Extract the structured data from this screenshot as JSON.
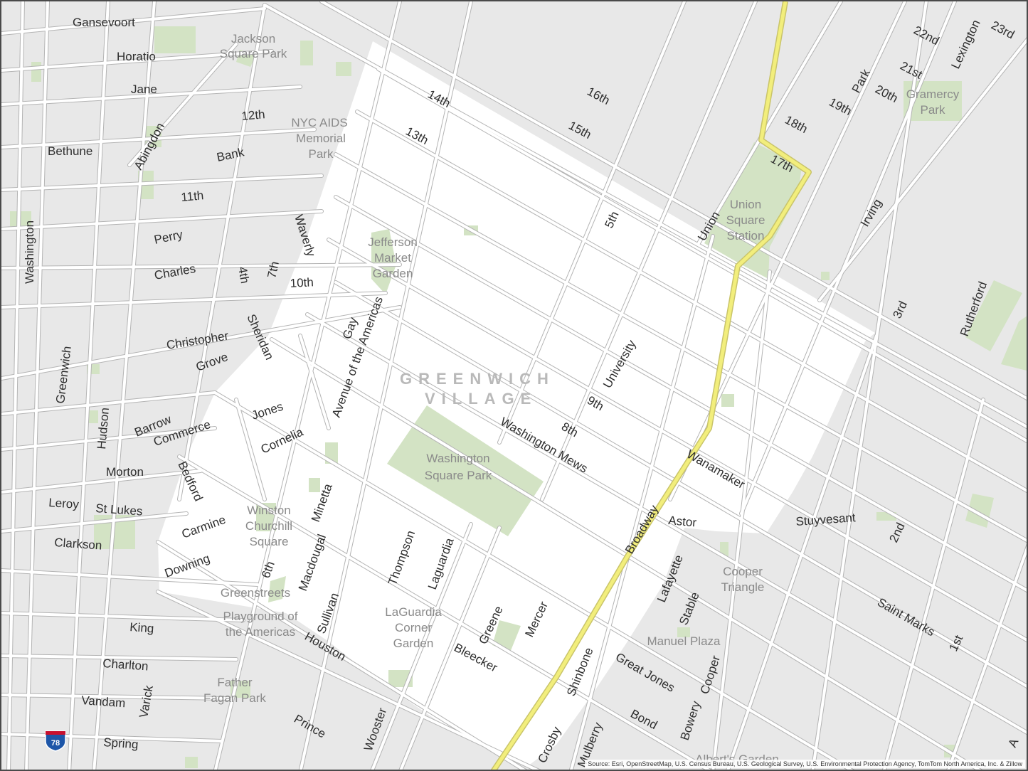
{
  "map": {
    "neighborhood": [
      "GREENWICH",
      "VILLAGE"
    ],
    "attribution": "Source: Esri, OpenStreetMap, U.S. Census Bureau, U.S. Geological Survey, U.S. Environmental Protection Agency, TomTom North America, Inc. & Zillow",
    "highway_shield": "78",
    "colors": {
      "background": "#e8e8e8",
      "district": "#ffffff",
      "park": "#d3e3c4",
      "road": "#ffffff",
      "road_casing": "#b4b4b4",
      "highlight_route": "#f2ee7c",
      "shield_blue": "#1d56a8",
      "shield_red": "#c8102e"
    },
    "parks": [
      "Jackson Square Park",
      "NYC AIDS Memorial Park",
      "Jefferson Market Garden",
      "Washington Square Park",
      "Union Square Station",
      "Gramercy Park",
      "Winston Churchill Square",
      "Greenstreets",
      "Playground of the Americas",
      "LaGuardia Corner Garden",
      "Father Fagan Park",
      "Cooper Triangle",
      "Manuel Plaza",
      "Albert's Garden"
    ],
    "streets": [
      "Gansevoort",
      "Horatio",
      "Jane",
      "12th",
      "Bethune",
      "Abingdon",
      "Bank",
      "11th",
      "Perry",
      "Charles",
      "10th",
      "Washington",
      "Greenwich",
      "Hudson",
      "Christopher",
      "Grove",
      "Barrow",
      "Commerce",
      "Jones",
      "Cornelia",
      "Morton",
      "Leroy",
      "St Lukes",
      "Clarkson",
      "Carmine",
      "Downing",
      "King",
      "Charlton",
      "Vandam",
      "Varick",
      "Spring",
      "Houston",
      "Prince",
      "Bedford",
      "4th",
      "7th",
      "Sheridan",
      "Waverly",
      "Gay",
      "6th",
      "Minetta",
      "Macdougal",
      "Sullivan",
      "Thompson",
      "Laguardia",
      "Wooster",
      "Greene",
      "Mercer",
      "Bleecker",
      "Crosby",
      "Mulberry",
      "Shinbone",
      "Broadway",
      "Lafayette",
      "Stable",
      "Bowery",
      "Cooper",
      "Great Jones",
      "Bond",
      "Astor",
      "Wanamaker",
      "Stuyvesant",
      "Saint Marks",
      "1st",
      "2nd",
      "3rd",
      "Rutherford",
      "Irving",
      "Union",
      "5th",
      "University",
      "9th",
      "8th",
      "Washington Mews",
      "14th",
      "13th",
      "15th",
      "16th",
      "17th",
      "18th",
      "19th",
      "20th",
      "21st",
      "22nd",
      "23rd",
      "Park",
      "Lexington",
      "A",
      "Avenue of the Americas"
    ]
  }
}
